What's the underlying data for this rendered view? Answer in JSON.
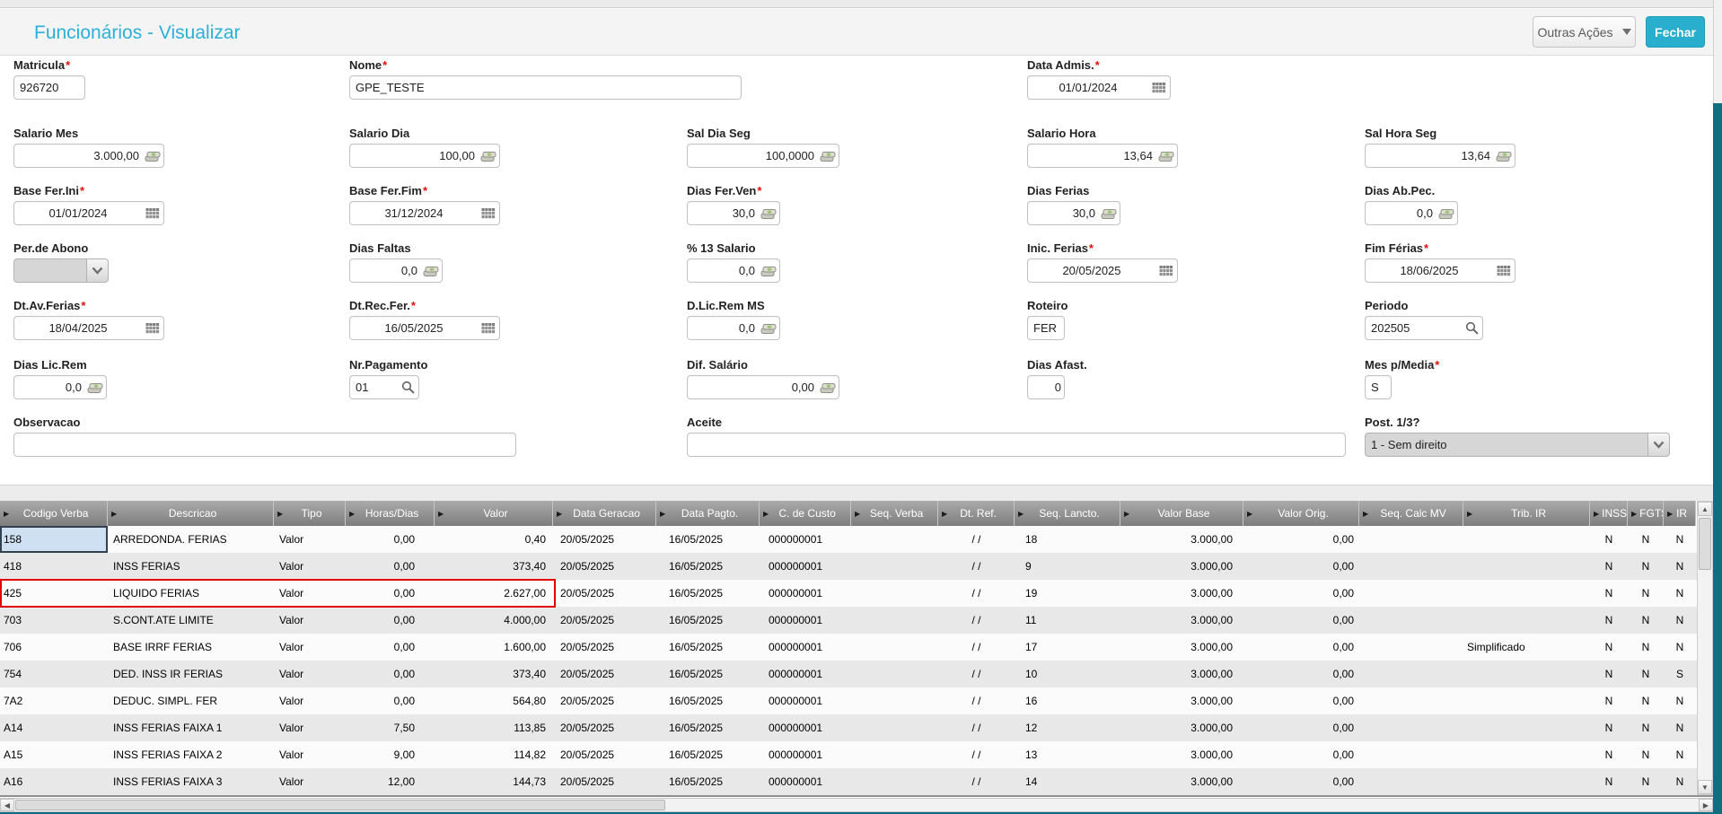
{
  "window": {
    "title": "Funcionários - Visualizar"
  },
  "toolbar": {
    "other_actions": "Outras Ações",
    "close": "Fechar"
  },
  "icons": {
    "calendar": "calendar-grid",
    "money": "coin-stack",
    "search": "magnifier",
    "dropdown": "chevron-down",
    "column_sort": "right-triangle"
  },
  "colors": {
    "title_blue": "#2BB0D9",
    "close_button_teal": "#29AFCD",
    "frame_teal": "#0F6E80",
    "row_highlight_border": "#E10000",
    "selected_cell_bg": "#CFE0F2",
    "table_header_gray": "#8F8F8F",
    "row_alt_gray": "#E8E8E8"
  },
  "form": {
    "fields": [
      {
        "id": "matricula",
        "label": "Matricula",
        "required": true,
        "value": "926720",
        "icon": "none",
        "disabled": false
      },
      {
        "id": "nome",
        "label": "Nome",
        "required": true,
        "value": "GPE_TESTE",
        "icon": "none",
        "disabled": false
      },
      {
        "id": "data_admis",
        "label": "Data Admis.",
        "required": true,
        "value": "01/01/2024",
        "icon": "calendar",
        "disabled": false
      },
      {
        "id": "salario_mes",
        "label": "Salario Mes",
        "required": false,
        "value": "3.000,00",
        "icon": "money",
        "disabled": false
      },
      {
        "id": "salario_dia",
        "label": "Salario Dia",
        "required": false,
        "value": "100,00",
        "icon": "money",
        "disabled": false
      },
      {
        "id": "sal_dia_seg",
        "label": "Sal Dia Seg",
        "required": false,
        "value": "100,0000",
        "icon": "money",
        "disabled": false
      },
      {
        "id": "salario_hora",
        "label": "Salario Hora",
        "required": false,
        "value": "13,64",
        "icon": "money",
        "disabled": false
      },
      {
        "id": "sal_hora_seg",
        "label": "Sal Hora Seg",
        "required": false,
        "value": "13,64",
        "icon": "money",
        "disabled": false
      },
      {
        "id": "base_fer_ini",
        "label": "Base Fer.Ini",
        "required": true,
        "value": "01/01/2024",
        "icon": "calendar",
        "disabled": false
      },
      {
        "id": "base_fer_fim",
        "label": "Base Fer.Fim",
        "required": true,
        "value": "31/12/2024",
        "icon": "calendar",
        "disabled": false
      },
      {
        "id": "dias_fer_ven",
        "label": "Dias Fer.Ven",
        "required": true,
        "value": "30,0",
        "icon": "money",
        "disabled": false
      },
      {
        "id": "dias_ferias",
        "label": "Dias Ferias",
        "required": false,
        "value": "30,0",
        "icon": "money",
        "disabled": false
      },
      {
        "id": "dias_ab_pec",
        "label": "Dias Ab.Pec.",
        "required": false,
        "value": "0,0",
        "icon": "money",
        "disabled": false
      },
      {
        "id": "per_abono",
        "label": "Per.de Abono",
        "required": false,
        "value": "",
        "icon": "select",
        "disabled": true
      },
      {
        "id": "dias_faltas",
        "label": "Dias Faltas",
        "required": false,
        "value": "0,0",
        "icon": "money",
        "disabled": false
      },
      {
        "id": "pct13",
        "label": "% 13 Salario",
        "required": false,
        "value": "0,0",
        "icon": "money",
        "disabled": false
      },
      {
        "id": "inic_ferias",
        "label": "Inic. Ferias",
        "required": true,
        "value": "20/05/2025",
        "icon": "calendar",
        "disabled": false
      },
      {
        "id": "fim_ferias",
        "label": "Fim Férias",
        "required": true,
        "value": "18/06/2025",
        "icon": "calendar",
        "disabled": false
      },
      {
        "id": "dt_av_ferias",
        "label": "Dt.Av.Ferias",
        "required": true,
        "value": "18/04/2025",
        "icon": "calendar",
        "disabled": false
      },
      {
        "id": "dt_rec_fer",
        "label": "Dt.Rec.Fer.",
        "required": true,
        "value": "16/05/2025",
        "icon": "calendar",
        "disabled": false
      },
      {
        "id": "d_lic_rem_ms",
        "label": "D.Lic.Rem MS",
        "required": false,
        "value": "0,0",
        "icon": "money",
        "disabled": false
      },
      {
        "id": "roteiro",
        "label": "Roteiro",
        "required": false,
        "value": "FER",
        "icon": "none",
        "disabled": false
      },
      {
        "id": "periodo",
        "label": "Periodo",
        "required": false,
        "value": "202505",
        "icon": "search",
        "disabled": false
      },
      {
        "id": "dias_lic_rem",
        "label": "Dias Lic.Rem",
        "required": false,
        "value": "0,0",
        "icon": "money",
        "disabled": false
      },
      {
        "id": "nr_pagamento",
        "label": "Nr.Pagamento",
        "required": false,
        "value": "01",
        "icon": "search",
        "disabled": false
      },
      {
        "id": "dif_salario",
        "label": "Dif. Salário",
        "required": false,
        "value": "0,00",
        "icon": "money",
        "disabled": false
      },
      {
        "id": "dias_afast",
        "label": "Dias Afast.",
        "required": false,
        "value": "0",
        "icon": "none",
        "disabled": false
      },
      {
        "id": "mes_p_media",
        "label": "Mes p/Media",
        "required": true,
        "value": "S",
        "icon": "none",
        "disabled": false
      },
      {
        "id": "observacao",
        "label": "Observacao",
        "required": false,
        "value": "",
        "icon": "none",
        "disabled": false
      },
      {
        "id": "aceite",
        "label": "Aceite",
        "required": false,
        "value": "",
        "icon": "none",
        "disabled": false
      },
      {
        "id": "post_13",
        "label": "Post. 1/3?",
        "required": false,
        "value": "1 - Sem direito",
        "icon": "select",
        "disabled": true
      }
    ]
  },
  "table": {
    "columns": [
      {
        "id": "codigo",
        "label": "Codigo Verba"
      },
      {
        "id": "descricao",
        "label": "Descricao"
      },
      {
        "id": "tipo",
        "label": "Tipo"
      },
      {
        "id": "horas_dias",
        "label": "Horas/Dias"
      },
      {
        "id": "valor",
        "label": "Valor"
      },
      {
        "id": "data_geracao",
        "label": "Data Geracao"
      },
      {
        "id": "data_pagto",
        "label": "Data Pagto."
      },
      {
        "id": "c_custo",
        "label": "C. de Custo"
      },
      {
        "id": "seq_verba",
        "label": "Seq. Verba"
      },
      {
        "id": "dt_ref",
        "label": "Dt. Ref."
      },
      {
        "id": "seq_lancto",
        "label": "Seq. Lancto."
      },
      {
        "id": "valor_base",
        "label": "Valor Base"
      },
      {
        "id": "valor_orig",
        "label": "Valor Orig."
      },
      {
        "id": "seq_calc_mv",
        "label": "Seq. Calc MV"
      },
      {
        "id": "trib_ir",
        "label": "Trib. IR"
      },
      {
        "id": "inss",
        "label": "INSS"
      },
      {
        "id": "fgts",
        "label": "FGTS"
      },
      {
        "id": "ir",
        "label": "IR"
      }
    ],
    "rows": [
      {
        "codigo": "158",
        "descricao": "ARREDONDA. FERIAS",
        "tipo": "Valor",
        "horas_dias": "0,00",
        "valor": "0,40",
        "data_geracao": "20/05/2025",
        "data_pagto": "16/05/2025",
        "c_custo": "000000001",
        "seq_verba": "",
        "dt_ref": "/ /",
        "seq_lancto": "18",
        "valor_base": "3.000,00",
        "valor_orig": "0,00",
        "seq_calc_mv": "",
        "trib_ir": "",
        "inss": "N",
        "fgts": "N",
        "ir": "N"
      },
      {
        "codigo": "418",
        "descricao": "INSS FERIAS",
        "tipo": "Valor",
        "horas_dias": "0,00",
        "valor": "373,40",
        "data_geracao": "20/05/2025",
        "data_pagto": "16/05/2025",
        "c_custo": "000000001",
        "seq_verba": "",
        "dt_ref": "/ /",
        "seq_lancto": "9",
        "valor_base": "3.000,00",
        "valor_orig": "0,00",
        "seq_calc_mv": "",
        "trib_ir": "",
        "inss": "N",
        "fgts": "N",
        "ir": "N"
      },
      {
        "codigo": "425",
        "descricao": "LIQUIDO FERIAS",
        "tipo": "Valor",
        "horas_dias": "0,00",
        "valor": "2.627,00",
        "data_geracao": "20/05/2025",
        "data_pagto": "16/05/2025",
        "c_custo": "000000001",
        "seq_verba": "",
        "dt_ref": "/ /",
        "seq_lancto": "19",
        "valor_base": "3.000,00",
        "valor_orig": "0,00",
        "seq_calc_mv": "",
        "trib_ir": "",
        "inss": "N",
        "fgts": "N",
        "ir": "N"
      },
      {
        "codigo": "703",
        "descricao": "S.CONT.ATE LIMITE",
        "tipo": "Valor",
        "horas_dias": "0,00",
        "valor": "4.000,00",
        "data_geracao": "20/05/2025",
        "data_pagto": "16/05/2025",
        "c_custo": "000000001",
        "seq_verba": "",
        "dt_ref": "/ /",
        "seq_lancto": "11",
        "valor_base": "3.000,00",
        "valor_orig": "0,00",
        "seq_calc_mv": "",
        "trib_ir": "",
        "inss": "N",
        "fgts": "N",
        "ir": "N"
      },
      {
        "codigo": "706",
        "descricao": "BASE IRRF FERIAS",
        "tipo": "Valor",
        "horas_dias": "0,00",
        "valor": "1.600,00",
        "data_geracao": "20/05/2025",
        "data_pagto": "16/05/2025",
        "c_custo": "000000001",
        "seq_verba": "",
        "dt_ref": "/ /",
        "seq_lancto": "17",
        "valor_base": "3.000,00",
        "valor_orig": "0,00",
        "seq_calc_mv": "",
        "trib_ir": "Simplificado",
        "inss": "N",
        "fgts": "N",
        "ir": "N"
      },
      {
        "codigo": "754",
        "descricao": "DED. INSS IR FERIAS",
        "tipo": "Valor",
        "horas_dias": "0,00",
        "valor": "373,40",
        "data_geracao": "20/05/2025",
        "data_pagto": "16/05/2025",
        "c_custo": "000000001",
        "seq_verba": "",
        "dt_ref": "/ /",
        "seq_lancto": "10",
        "valor_base": "3.000,00",
        "valor_orig": "0,00",
        "seq_calc_mv": "",
        "trib_ir": "",
        "inss": "N",
        "fgts": "N",
        "ir": "S"
      },
      {
        "codigo": "7A2",
        "descricao": "DEDUC. SIMPL. FER",
        "tipo": "Valor",
        "horas_dias": "0,00",
        "valor": "564,80",
        "data_geracao": "20/05/2025",
        "data_pagto": "16/05/2025",
        "c_custo": "000000001",
        "seq_verba": "",
        "dt_ref": "/ /",
        "seq_lancto": "16",
        "valor_base": "3.000,00",
        "valor_orig": "0,00",
        "seq_calc_mv": "",
        "trib_ir": "",
        "inss": "N",
        "fgts": "N",
        "ir": "N"
      },
      {
        "codigo": "A14",
        "descricao": "INSS FERIAS FAIXA 1",
        "tipo": "Valor",
        "horas_dias": "7,50",
        "valor": "113,85",
        "data_geracao": "20/05/2025",
        "data_pagto": "16/05/2025",
        "c_custo": "000000001",
        "seq_verba": "",
        "dt_ref": "/ /",
        "seq_lancto": "12",
        "valor_base": "3.000,00",
        "valor_orig": "0,00",
        "seq_calc_mv": "",
        "trib_ir": "",
        "inss": "N",
        "fgts": "N",
        "ir": "N"
      },
      {
        "codigo": "A15",
        "descricao": "INSS FERIAS FAIXA 2",
        "tipo": "Valor",
        "horas_dias": "9,00",
        "valor": "114,82",
        "data_geracao": "20/05/2025",
        "data_pagto": "16/05/2025",
        "c_custo": "000000001",
        "seq_verba": "",
        "dt_ref": "/ /",
        "seq_lancto": "13",
        "valor_base": "3.000,00",
        "valor_orig": "0,00",
        "seq_calc_mv": "",
        "trib_ir": "",
        "inss": "N",
        "fgts": "N",
        "ir": "N"
      },
      {
        "codigo": "A16",
        "descricao": "INSS FERIAS FAIXA 3",
        "tipo": "Valor",
        "horas_dias": "12,00",
        "valor": "144,73",
        "data_geracao": "20/05/2025",
        "data_pagto": "16/05/2025",
        "c_custo": "000000001",
        "seq_verba": "",
        "dt_ref": "/ /",
        "seq_lancto": "14",
        "valor_base": "3.000,00",
        "valor_orig": "0,00",
        "seq_calc_mv": "",
        "trib_ir": "",
        "inss": "N",
        "fgts": "N",
        "ir": "N"
      }
    ],
    "selected_cell": {
      "row": 0,
      "column": "codigo"
    },
    "highlighted_row": 2
  }
}
